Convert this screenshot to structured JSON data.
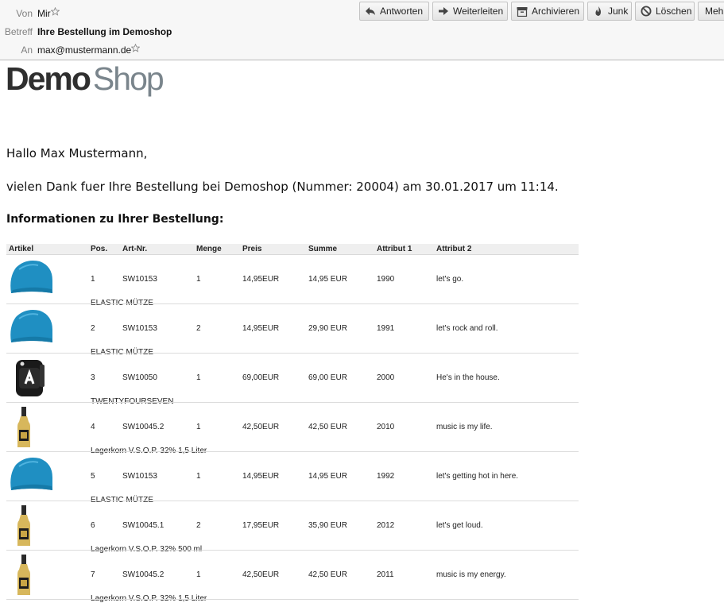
{
  "header": {
    "from_label": "Von",
    "from_value": "Mir",
    "subject_label": "Betreff",
    "subject_value": "Ihre Bestellung im Demoshop",
    "to_label": "An",
    "to_value": "max@mustermann.de"
  },
  "toolbar": {
    "reply": "Antworten",
    "forward": "Weiterleiten",
    "archive": "Archivieren",
    "junk": "Junk",
    "delete": "Löschen",
    "more": "Mehr"
  },
  "logo": {
    "part1": "Demo",
    "part2": "Shop"
  },
  "greeting": "Hallo Max Mustermann,",
  "intro": "vielen Dank fuer Ihre Bestellung bei Demoshop (Nummer: 20004) am 30.01.2017 um 11:14.",
  "info_heading": "Informationen zu Ihrer Bestellung:",
  "table": {
    "headers": [
      "Artikel",
      "Pos.",
      "Art-Nr.",
      "Menge",
      "Preis",
      "Summe",
      "Attribut 1",
      "Attribut 2"
    ],
    "rows": [
      {
        "image": "blue-beanie",
        "pos": "1",
        "artnr": "SW10153",
        "menge": "1",
        "preis": "14,95EUR",
        "summe": "14,95 EUR",
        "attr1": "1990",
        "attr2": "let's go.",
        "name": "ELASTIC MÜTZE"
      },
      {
        "image": "blue-beanie",
        "pos": "2",
        "artnr": "SW10153",
        "menge": "2",
        "preis": "14,95EUR",
        "summe": "29,90 EUR",
        "attr1": "1991",
        "attr2": "let's rock and roll.",
        "name": "ELASTIC MÜTZE"
      },
      {
        "image": "black-backpack",
        "pos": "3",
        "artnr": "SW10050",
        "menge": "1",
        "preis": "69,00EUR",
        "summe": "69,00 EUR",
        "attr1": "2000",
        "attr2": "He's in the house.",
        "name": "TWENTYFOURSEVEN"
      },
      {
        "image": "liquor-bottle",
        "pos": "4",
        "artnr": "SW10045.2",
        "menge": "1",
        "preis": "42,50EUR",
        "summe": "42,50 EUR",
        "attr1": "2010",
        "attr2": "music is my life.",
        "name": "Lagerkorn V.S.O.P. 32% 1,5 Liter"
      },
      {
        "image": "blue-beanie",
        "pos": "5",
        "artnr": "SW10153",
        "menge": "1",
        "preis": "14,95EUR",
        "summe": "14,95 EUR",
        "attr1": "1992",
        "attr2": "let's getting hot in here.",
        "name": "ELASTIC MÜTZE"
      },
      {
        "image": "liquor-bottle",
        "pos": "6",
        "artnr": "SW10045.1",
        "menge": "2",
        "preis": "17,95EUR",
        "summe": "35,90 EUR",
        "attr1": "2012",
        "attr2": "let's get loud.",
        "name": "Lagerkorn V.S.O.P. 32% 500 ml"
      },
      {
        "image": "liquor-bottle",
        "pos": "7",
        "artnr": "SW10045.2",
        "menge": "1",
        "preis": "42,50EUR",
        "summe": "42,50 EUR",
        "attr1": "2011",
        "attr2": "music is my energy.",
        "name": "Lagerkorn V.S.O.P. 32% 1,5 Liter"
      }
    ]
  },
  "colors": {
    "header_bg": "#f7f7f7",
    "beanie": "#1f8fc2",
    "logo_dark": "#2f2f2f",
    "logo_light": "#7a858c"
  }
}
